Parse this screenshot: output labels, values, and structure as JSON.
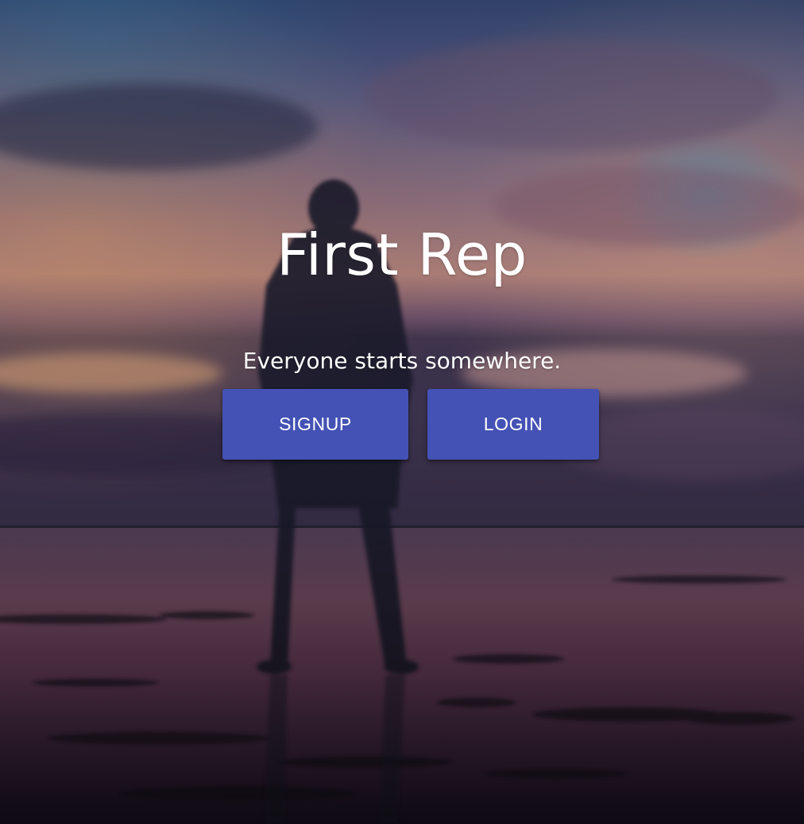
{
  "hero": {
    "title": "First Rep",
    "tagline": "Everyone starts somewhere.",
    "background_icon": "hooded-person-on-beach-at-sunset-photo"
  },
  "actions": {
    "signup_label": "SIGNUP",
    "login_label": "LOGIN"
  },
  "colors": {
    "button_bg": "#4452b5",
    "text": "#ffffff"
  }
}
